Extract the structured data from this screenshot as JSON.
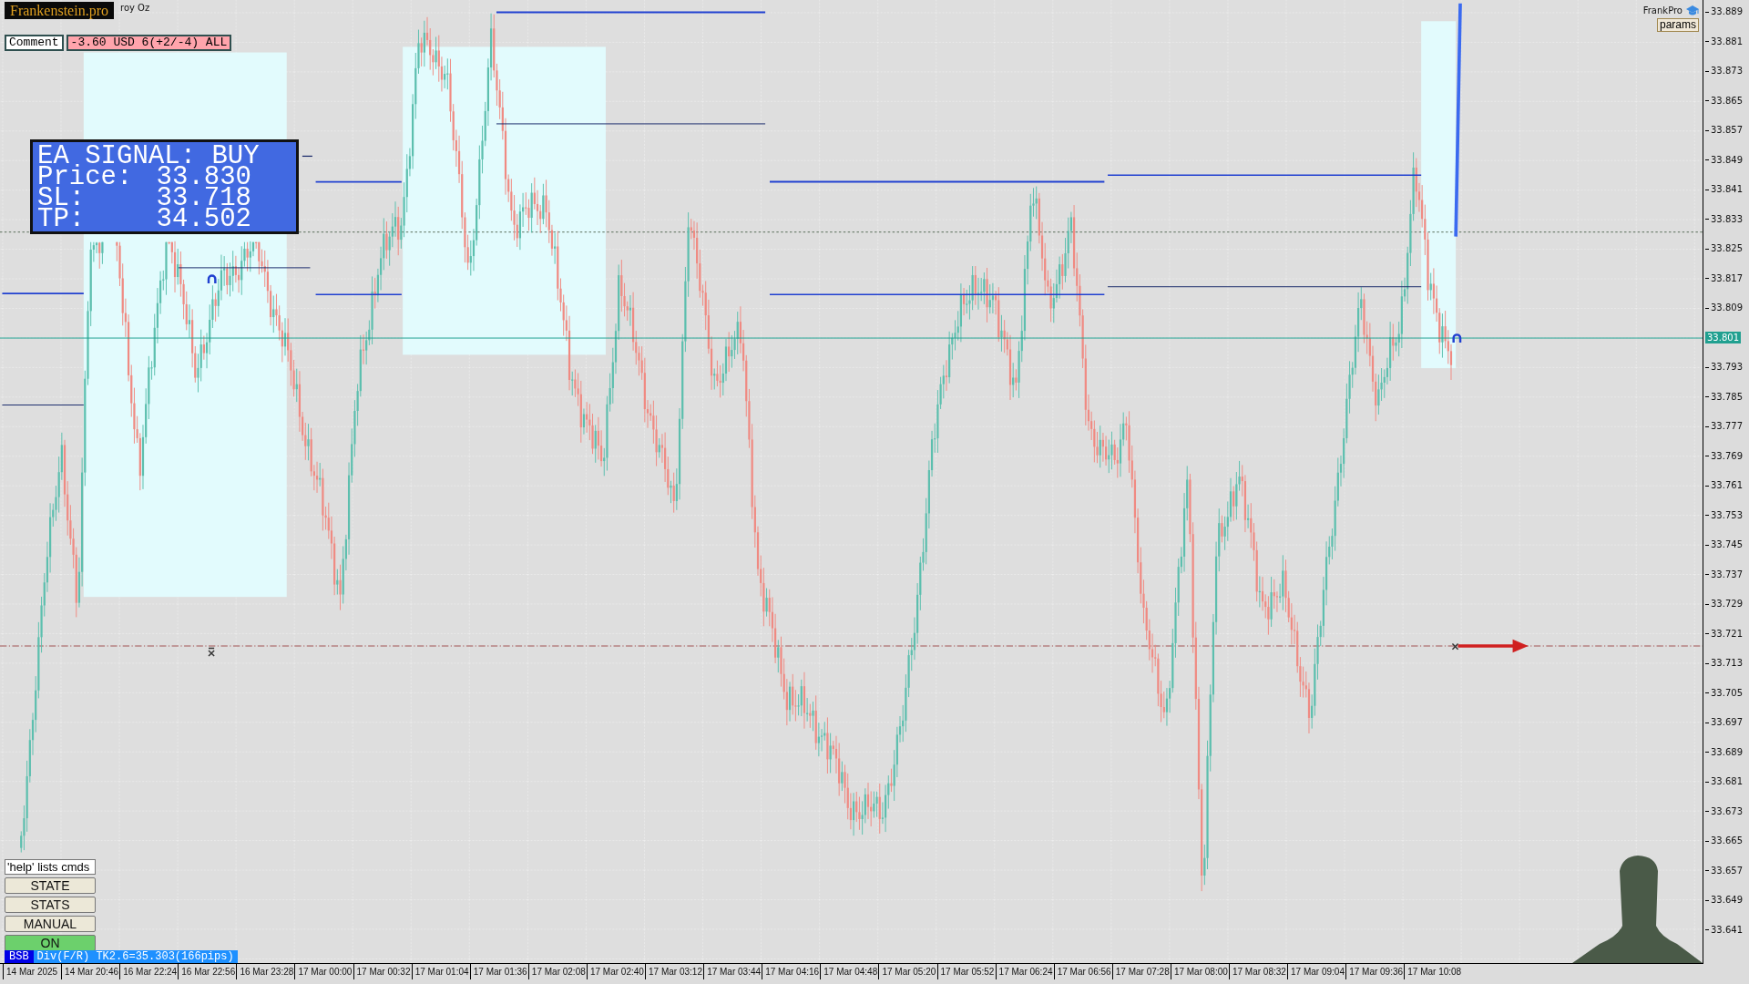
{
  "logo": {
    "text": "Frankenstein.pro"
  },
  "symbol_description": "roy Oz",
  "comment_panel": {
    "label": "Comment",
    "result": "-3.60 USD 6(+2/-4) ALL"
  },
  "signal_box": {
    "title": "EA SIGNAL: BUY",
    "rows": [
      {
        "label": "Price:",
        "value": "33.830"
      },
      {
        "label": "SL:",
        "value": "33.718"
      },
      {
        "label": "TP:",
        "value": "34.502"
      }
    ]
  },
  "top_right": {
    "brand": "FrankPro",
    "params_button": "params"
  },
  "control_panel": {
    "hint": "'help' lists cmds",
    "buttons": [
      {
        "label": "STATE",
        "on": false
      },
      {
        "label": "STATS",
        "on": false
      },
      {
        "label": "MANUAL",
        "on": false
      },
      {
        "label": "ON",
        "on": true
      }
    ]
  },
  "status_line": {
    "tag": "BSB",
    "text": "Div(F/R) TK2.6=35.303(166pips)"
  },
  "price_axis": {
    "ticks": [
      {
        "label": "33.889",
        "kind": "tick"
      },
      {
        "label": "33.881",
        "kind": "tick"
      },
      {
        "label": "33.873",
        "kind": "tick"
      },
      {
        "label": "33.865",
        "kind": "tick"
      },
      {
        "label": "33.857",
        "kind": "tick"
      },
      {
        "label": "33.849",
        "kind": "tick"
      },
      {
        "label": "33.841",
        "kind": "tick"
      },
      {
        "label": "33.833",
        "kind": "tick"
      },
      {
        "label": "33.825",
        "kind": "tick"
      },
      {
        "label": "33.817",
        "kind": "tick"
      },
      {
        "label": "33.809",
        "kind": "tick"
      },
      {
        "label": "33.801",
        "kind": "current"
      },
      {
        "label": "33.793",
        "kind": "tick"
      },
      {
        "label": "33.785",
        "kind": "tick"
      },
      {
        "label": "33.777",
        "kind": "tick"
      },
      {
        "label": "33.769",
        "kind": "tick"
      },
      {
        "label": "33.761",
        "kind": "tick"
      },
      {
        "label": "33.753",
        "kind": "tick"
      },
      {
        "label": "33.745",
        "kind": "tick"
      },
      {
        "label": "33.737",
        "kind": "tick"
      },
      {
        "label": "33.729",
        "kind": "tick"
      },
      {
        "label": "33.721",
        "kind": "tick"
      },
      {
        "label": "33.713",
        "kind": "tick"
      },
      {
        "label": "33.705",
        "kind": "tick"
      },
      {
        "label": "33.697",
        "kind": "tick"
      },
      {
        "label": "33.689",
        "kind": "tick"
      },
      {
        "label": "33.681",
        "kind": "tick"
      },
      {
        "label": "33.673",
        "kind": "tick"
      },
      {
        "label": "33.665",
        "kind": "tick"
      },
      {
        "label": "33.657",
        "kind": "tick"
      },
      {
        "label": "33.649",
        "kind": "tick"
      },
      {
        "label": "33.641",
        "kind": "tick"
      }
    ]
  },
  "time_axis": {
    "labels": [
      "14 Mar 2025",
      "14 Mar 20:46",
      "16 Mar 22:24",
      "16 Mar 22:56",
      "16 Mar 23:28",
      "17 Mar 00:00",
      "17 Mar 00:32",
      "17 Mar 01:04",
      "17 Mar 01:36",
      "17 Mar 02:08",
      "17 Mar 02:40",
      "17 Mar 03:12",
      "17 Mar 03:44",
      "17 Mar 04:16",
      "17 Mar 04:48",
      "17 Mar 05:20",
      "17 Mar 05:52",
      "17 Mar 06:24",
      "17 Mar 06:56",
      "17 Mar 07:28",
      "17 Mar 08:00",
      "17 Mar 08:32",
      "17 Mar 09:04",
      "17 Mar 09:36",
      "17 Mar 10:08"
    ]
  }
}
